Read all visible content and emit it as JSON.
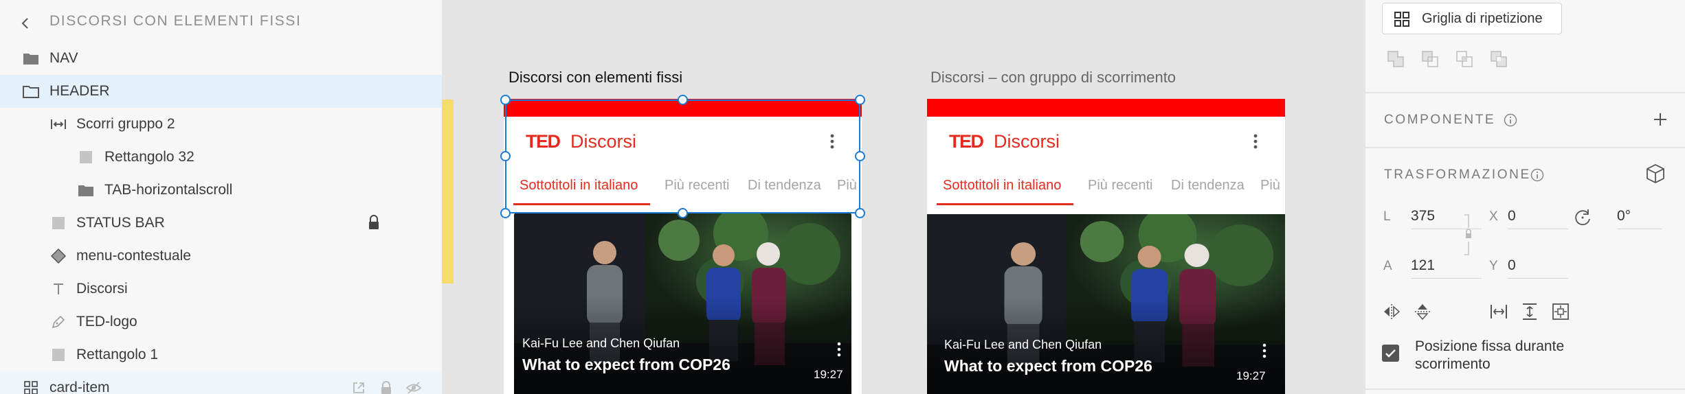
{
  "layers_panel": {
    "title": "DISCORSI CON ELEMENTI FISSI",
    "items": [
      {
        "label": "NAV",
        "icon": "folder-icon"
      },
      {
        "label": "HEADER",
        "icon": "folder-icon",
        "selected": true
      },
      {
        "label": "Scorri gruppo 2",
        "icon": "scroll-group-icon"
      },
      {
        "label": "Rettangolo 32",
        "icon": "rectangle-icon"
      },
      {
        "label": "TAB-horizontalscroll",
        "icon": "folder-icon"
      },
      {
        "label": "STATUS BAR",
        "icon": "rectangle-icon",
        "locked": true
      },
      {
        "label": "menu-contestuale",
        "icon": "component-icon"
      },
      {
        "label": "Discorsi",
        "icon": "text-icon"
      },
      {
        "label": "TED-logo",
        "icon": "pen-icon"
      },
      {
        "label": "Rettangolo 1",
        "icon": "rectangle-icon"
      },
      {
        "label": "card-item",
        "icon": "repeat-grid-icon"
      }
    ]
  },
  "canvas": {
    "artboards": [
      {
        "title": "Discorsi con elementi fissi",
        "logo": "TED",
        "app_title": "Discorsi",
        "tabs": [
          "Sottotitoli in italiano",
          "Più recenti",
          "Di tendenza",
          "Più"
        ],
        "card": {
          "speakers": "Kai-Fu Lee and Chen Qiufan",
          "title": "What to expect from COP26",
          "duration": "19:27"
        }
      },
      {
        "title": "Discorsi – con gruppo di scorrimento",
        "logo": "TED",
        "app_title": "Discorsi",
        "tabs": [
          "Sottotitoli in italiano",
          "Più recenti",
          "Di tendenza",
          "Più"
        ],
        "card": {
          "speakers": "Kai-Fu Lee and Chen Qiufan",
          "title": "What to expect from COP26",
          "duration": "19:27"
        }
      }
    ]
  },
  "properties": {
    "repeat_grid_label": "Griglia di ripetizione",
    "component_title": "COMPONENTE",
    "transform_title": "TRASFORMAZIONE",
    "fields": {
      "w_label": "L",
      "w_value": "375",
      "h_label": "A",
      "h_value": "121",
      "x_label": "X",
      "x_value": "0",
      "y_label": "Y",
      "y_value": "0",
      "rotation_value": "0°"
    },
    "fixed_position_label": "Posizione fissa durante scorrimento",
    "fixed_position_checked": true
  },
  "colors": {
    "ted_red": "#e62b1e",
    "status_red": "#ff0000",
    "selection_blue": "#1a7bd6",
    "selected_row": "#e4f0fa"
  }
}
